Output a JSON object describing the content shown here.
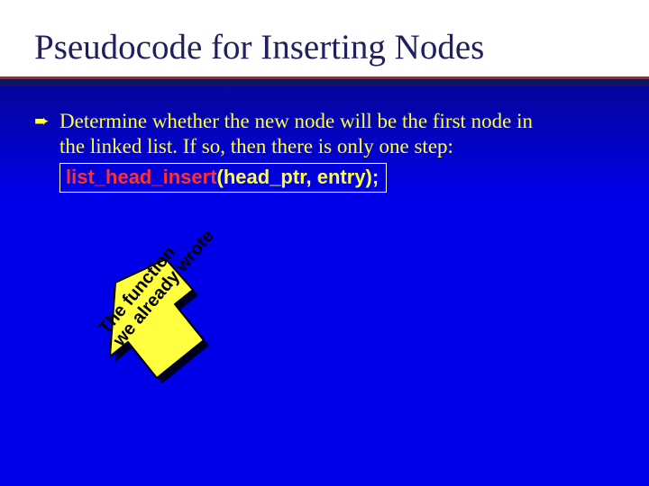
{
  "title": "Pseudocode for Inserting Nodes",
  "bullet": {
    "glyph": "➨",
    "text_line1": "Determine whether the new node will be the first node in",
    "text_line2": "the linked list.  If so, then there is only one step:"
  },
  "code": {
    "fn": "list_head_insert",
    "args": "(head_ptr, entry);"
  },
  "arrow": {
    "line1": "The function",
    "line2": "we already wrote"
  }
}
